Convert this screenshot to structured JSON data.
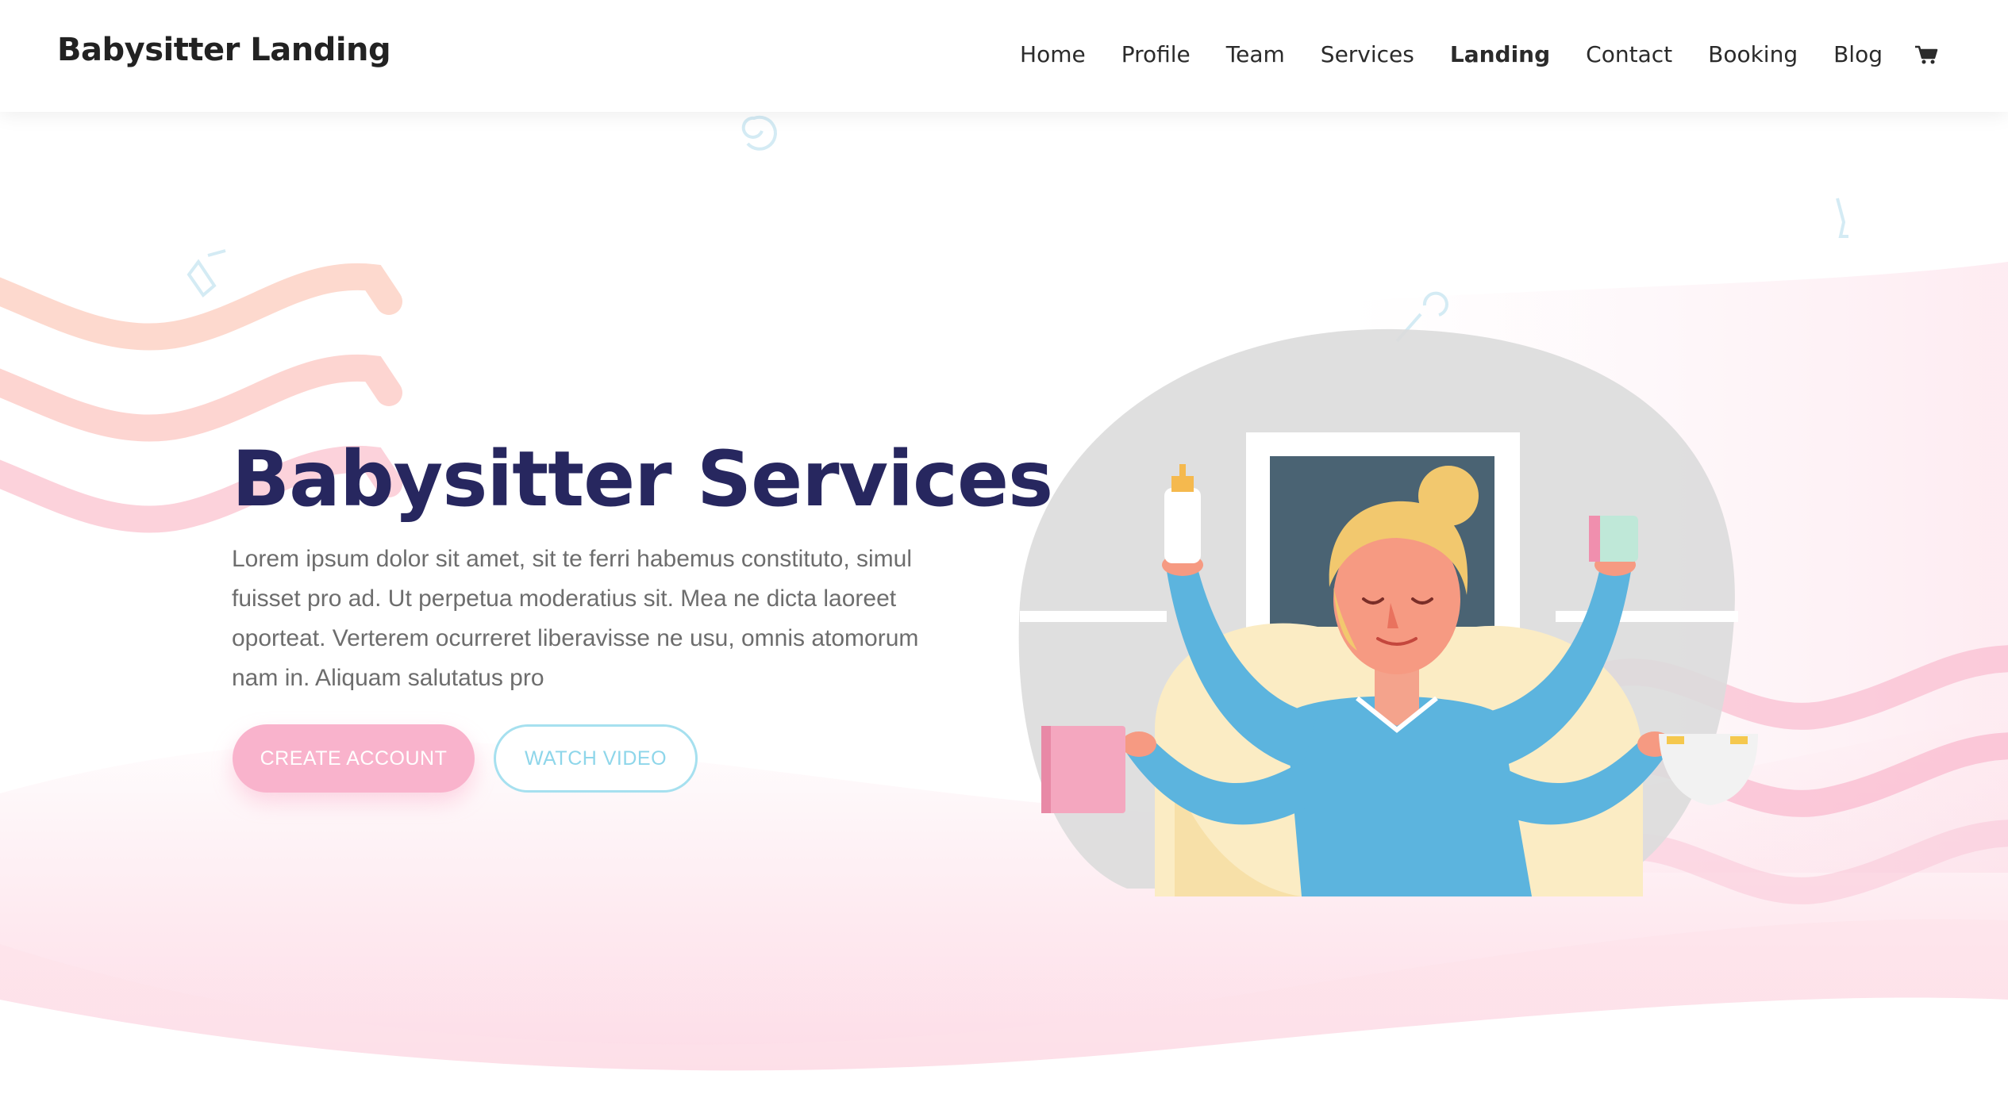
{
  "header": {
    "logo": "Babysitter Landing",
    "nav": [
      {
        "label": "Home"
      },
      {
        "label": "Profile"
      },
      {
        "label": "Team"
      },
      {
        "label": "Services"
      },
      {
        "label": "Landing"
      },
      {
        "label": "Contact"
      },
      {
        "label": "Booking"
      },
      {
        "label": "Blog"
      }
    ],
    "active_nav": "Landing",
    "cart_icon": "shopping-cart-icon"
  },
  "hero": {
    "title": "Babysitter Services",
    "description": "Lorem ipsum dolor sit amet, sit te ferri habemus constituto, simul fuisset pro ad. Ut perpetua moderatius sit. Mea ne dicta laoreet oporteat. Verterem ocurreret liberavisse ne usu, omnis atomorum nam in. Aliquam salutatus pro",
    "primary_button": "CREATE ACCOUNT",
    "secondary_button": "WATCH VIDEO"
  },
  "illustration": {
    "subject": "babysitter-multitasking-illustration"
  },
  "colors": {
    "title": "#27275f",
    "primary_button": "#f9b3cc",
    "secondary_button_border": "#a6e0ef",
    "wave_pink": "#fbc9d8",
    "wave_peach": "#fdd2c2"
  }
}
